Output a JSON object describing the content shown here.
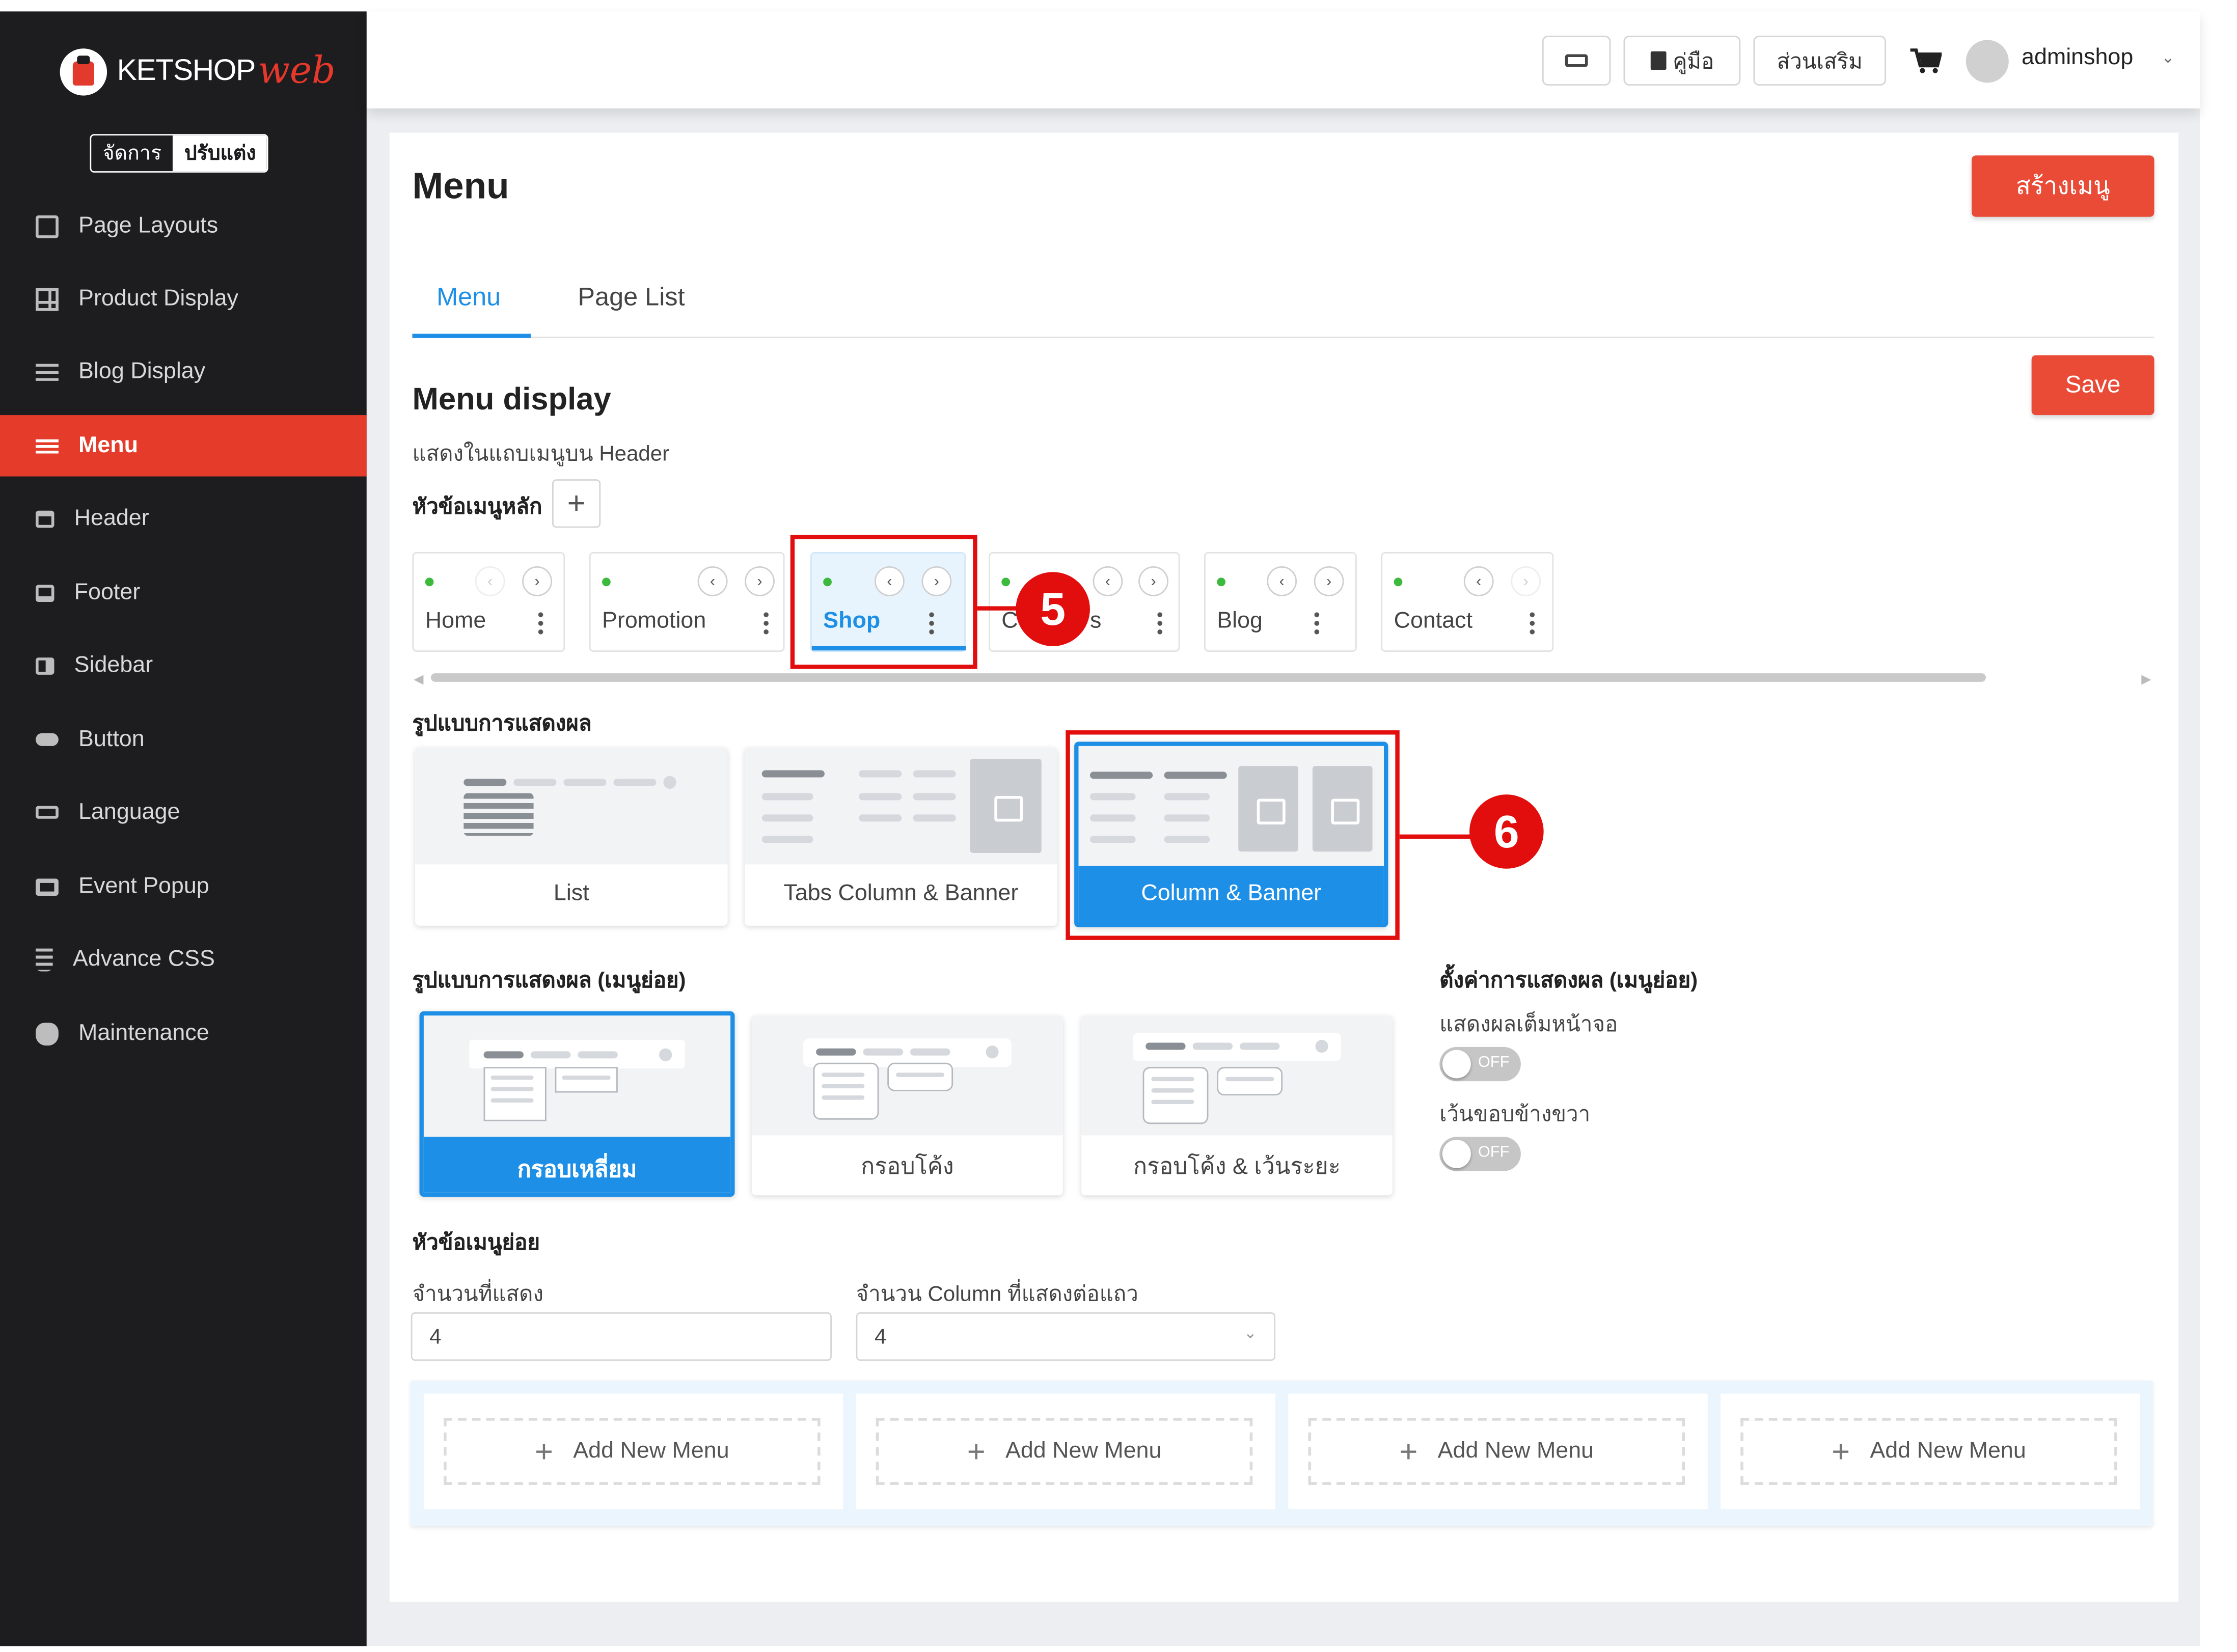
{
  "app": {
    "logo_text": "KETSHOP",
    "logo_script": "web",
    "mode_manage": "จัดการ",
    "mode_customize": "ปรับแต่ง"
  },
  "sidebar": {
    "items": [
      {
        "label": "Page Layouts",
        "icon": "page-layouts-icon"
      },
      {
        "label": "Product Display",
        "icon": "product-display-icon"
      },
      {
        "label": "Blog Display",
        "icon": "blog-display-icon"
      },
      {
        "label": "Menu",
        "icon": "menu-icon",
        "active": true
      },
      {
        "label": "Header",
        "icon": "header-icon"
      },
      {
        "label": "Footer",
        "icon": "footer-icon"
      },
      {
        "label": "Sidebar",
        "icon": "sidebar-icon"
      },
      {
        "label": "Button",
        "icon": "button-icon"
      },
      {
        "label": "Language",
        "icon": "language-icon"
      },
      {
        "label": "Event Popup",
        "icon": "event-popup-icon"
      },
      {
        "label": "Advance CSS",
        "icon": "css-icon"
      },
      {
        "label": "Maintenance",
        "icon": "maintenance-icon"
      }
    ]
  },
  "topbar": {
    "manual_label": "คู่มือ",
    "addons_label": "ส่วนเสริม",
    "username": "adminshop"
  },
  "page": {
    "title": "Menu",
    "create_button": "สร้างเมนู",
    "tabs": [
      {
        "label": "Menu",
        "active": true
      },
      {
        "label": "Page List",
        "active": false
      }
    ],
    "save_button": "Save"
  },
  "menu_display": {
    "title": "Menu display",
    "subtitle": "แสดงในแถบเมนูบน Header",
    "main_items_label": "หัวข้อเมนูหลัก",
    "items": [
      {
        "label": "Home"
      },
      {
        "label": "Promotion"
      },
      {
        "label": "Shop",
        "selected": true
      },
      {
        "label": "Contact Us"
      },
      {
        "label": "Blog"
      },
      {
        "label": "Contact"
      }
    ],
    "chip_text_visible": {
      "c": "C",
      "s": "s"
    },
    "display_style_label": "รูปแบบการแสดงผล",
    "display_styles": [
      {
        "label": "List"
      },
      {
        "label": "Tabs Column & Banner"
      },
      {
        "label": "Column & Banner",
        "selected": true
      }
    ],
    "submenu_style_label": "รูปแบบการแสดงผล (เมนูย่อย)",
    "submenu_styles": [
      {
        "label": "กรอบเหลี่ยม",
        "selected": true
      },
      {
        "label": "กรอบโค้ง"
      },
      {
        "label": "กรอบโค้ง & เว้นระยะ"
      }
    ],
    "submenu_settings_label": "ตั้งค่าการแสดงผล (เมนูย่อย)",
    "full_screen_label": "แสดงผลเต็มหน้าจอ",
    "full_screen_state": "OFF",
    "right_margin_label": "เว้นขอบข้างขวา",
    "right_margin_state": "OFF",
    "submenu_items_label": "หัวข้อเมนูย่อย",
    "count_label": "จำนวนที่แสดง",
    "count_value": "4",
    "columns_label": "จำนวน Column ที่แสดงต่อแถว",
    "columns_value": "4",
    "add_new_label": "Add New Menu"
  },
  "annotations": {
    "step5": "5",
    "step6": "6"
  },
  "colors": {
    "accent": "#1e8fe6",
    "brand_red": "#e43b2b",
    "annotation_red": "#e20d0d",
    "sidebar_bg": "#1d1d1f"
  }
}
